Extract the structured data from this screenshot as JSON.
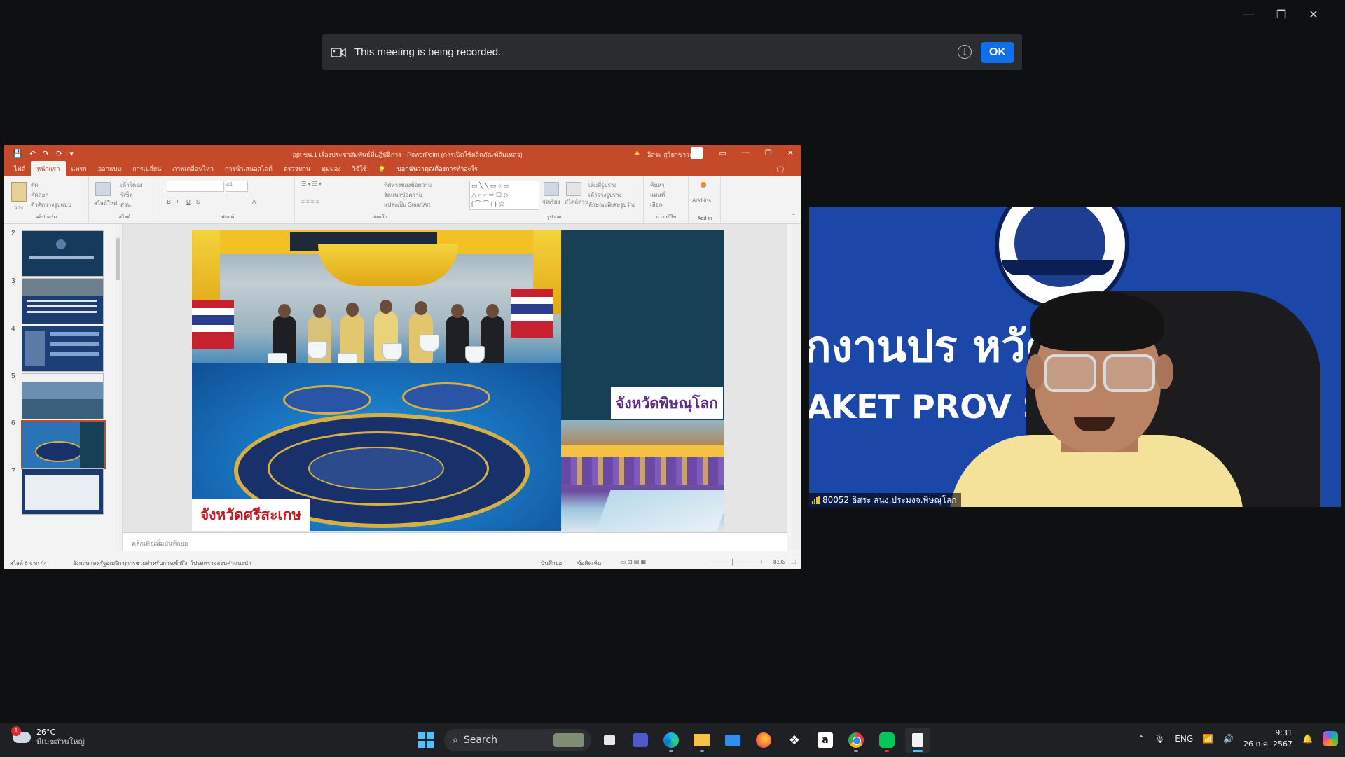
{
  "window_controls": {
    "minimize": "—",
    "maximize": "❐",
    "close": "✕"
  },
  "banner": {
    "message": "This meeting is being recorded.",
    "info": "i",
    "ok_label": "OK"
  },
  "ppt": {
    "title": "ppt ขน.1 เรื่องประชาสัมพันธ์ที่ปฎิบัติการ - PowerPoint (การเปิดใช้ผลิตภัณฑ์ล้มเหลว)",
    "user": "อิสระ สุวิยาขาวตรี",
    "qat": [
      "💾",
      "↶",
      "↷",
      "⟳",
      "▾"
    ],
    "tabs": [
      "ไฟล์",
      "หน้าแรก",
      "แทรก",
      "ออกแบบ",
      "การเปลี่ยน",
      "ภาพเคลื่อนไหว",
      "การนำเสนอสไลด์",
      "ตรวจทาน",
      "มุมมอง",
      "วิธีใช้"
    ],
    "tell_me": "บอกฉันว่าคุณต้องการทำอะไร",
    "ribbon": {
      "clipboard": "คลิปบอร์ด",
      "paste": "วาง",
      "cut": "ตัด",
      "copy": "คัดลอก",
      "format_painter": "ตัวคัดวางรูปแบบ",
      "slides": "สไลด์",
      "new_slide": "สไลด์ใหม่",
      "layout": "เค้าโครง",
      "reset": "รีเซ็ต",
      "section": "ส่วน",
      "font": "ฟอนต์",
      "font_size": "44",
      "paragraph": "ย่อหน้า",
      "text_direction": "ทิศทางของข้อความ",
      "align_text": "จัดแนวข้อความ",
      "smartart": "แปลงเป็น SmartArt",
      "drawing": "รูปวาด",
      "arrange": "จัดเรียง",
      "quick_styles": "สไตล์ด่วน",
      "shape_fill": "เติมสีรูปร่าง",
      "shape_outline": "เค้าร่างรูปร่าง",
      "shape_effects": "ลักษณะพิเศษรูปร่าง",
      "editing": "การแก้ไข",
      "find": "ค้นหา",
      "replace": "แทนที่",
      "select": "เลือก",
      "addins": "Add-ins",
      "addins_group": "Add-in"
    },
    "thumbnails": [
      {
        "num": "2"
      },
      {
        "num": "3"
      },
      {
        "num": "4"
      },
      {
        "num": "5"
      },
      {
        "num": "6",
        "selected": true
      },
      {
        "num": "7"
      }
    ],
    "slide": {
      "caption_left": "จังหวัดศรีสะเกษ",
      "caption_right": "จังหวัดพิษณุโลก"
    },
    "notes_placeholder": "คลิกเพื่อเพิ่มบันทึกย่อ",
    "status": {
      "slide_count": "สไลด์ 6 จาก 44",
      "language": "อังกฤษ (สหรัฐอเมริกา)",
      "accessibility": "การช่วยสำหรับการเข้าถึง: โปรดตรวจสอบคำแนะนำ",
      "notes": "บันทึกย่อ",
      "comments": "ข้อคิดเห็น",
      "zoom": "81%"
    }
  },
  "video": {
    "bg_line1": "ักงานปร   หวัดศรีสะเ",
    "bg_line2": "AKET PROV      SHERIES OFF",
    "participant": "80052 อิสระ สนง.ประมงจ.พิษณุโลก"
  },
  "taskbar": {
    "weather_temp": "26°C",
    "weather_desc": "มีเมฆส่วนใหญ่",
    "weather_badge": "1",
    "search_placeholder": "Search",
    "lang": "ENG",
    "time": "9:31",
    "date": "26 ก.ค. 2567"
  }
}
